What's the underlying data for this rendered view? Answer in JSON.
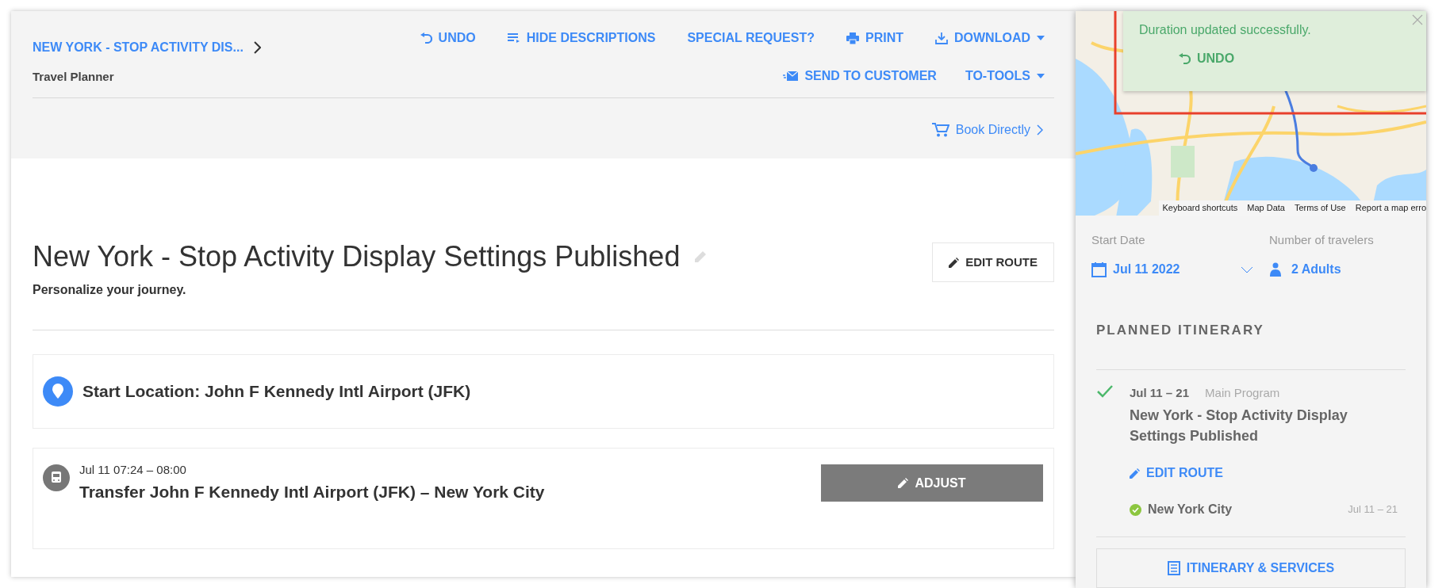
{
  "header": {
    "breadcrumb": "NEW YORK - STOP ACTIVITY DIS...",
    "subtitle": "Travel Planner",
    "actions": [
      {
        "label": "UNDO"
      },
      {
        "label": "HIDE DESCRIPTIONS"
      },
      {
        "label": "SPECIAL REQUEST?"
      },
      {
        "label": "PRINT"
      },
      {
        "label": "DOWNLOAD",
        "dropdown": true
      }
    ],
    "actions_row2": [
      {
        "label": "SEND TO CUSTOMER"
      },
      {
        "label": "TO-TOOLS",
        "dropdown": true
      }
    ],
    "book_link": "Book Directly"
  },
  "route": {
    "title": "New York - Stop Activity Display Settings Published",
    "subtitle": "Personalize your journey.",
    "edit_button": "EDIT ROUTE"
  },
  "segments": [
    {
      "kind": "location",
      "title": "Start Location: John F Kennedy Intl Airport (JFK)"
    },
    {
      "kind": "transfer",
      "time": "Jul 11 07:24 – 08:00",
      "title": "Transfer John F Kennedy Intl Airport (JFK) – New York City",
      "button": "ADJUST"
    }
  ],
  "map": {
    "footer_links": [
      "Keyboard shortcuts",
      "Map Data",
      "Terms of Use",
      "Report a map erro"
    ]
  },
  "toast": {
    "message": "Duration updated successfully.",
    "action": "UNDO"
  },
  "trip": {
    "start_date_label": "Start Date",
    "start_date": "Jul 11 2022",
    "travelers_label": "Number of travelers",
    "travelers": "2 Adults"
  },
  "itinerary": {
    "heading": "PLANNED ITINERARY",
    "program": {
      "dates": "Jul 11 – 21",
      "type": "Main Program",
      "title": "New York - Stop Activity Display Settings Published",
      "edit": "EDIT ROUTE",
      "checked": true
    },
    "stops": [
      {
        "name": "New York City",
        "dates": "Jul 11 – 21",
        "checked": true
      }
    ],
    "button": "ITINERARY & SERVICES"
  }
}
